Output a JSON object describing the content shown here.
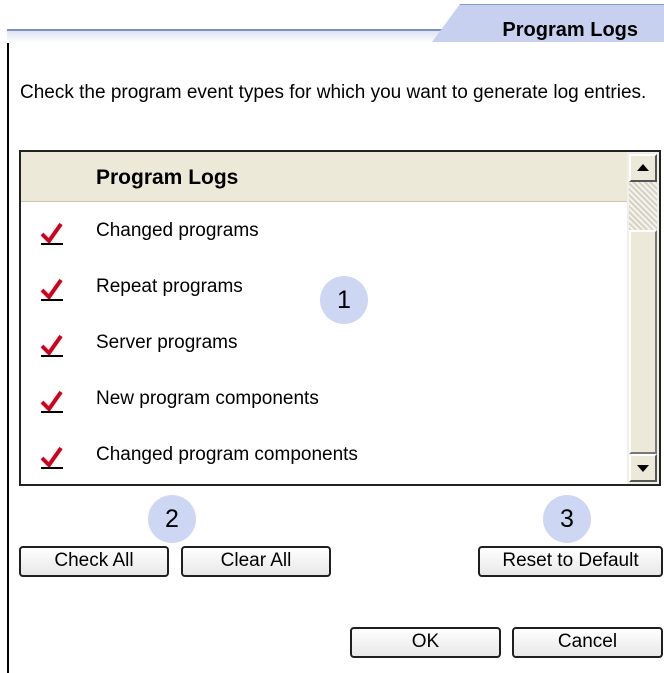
{
  "tab": {
    "label": "Program Logs"
  },
  "instructions": "Check the program event types for which you want to generate log entries.",
  "list": {
    "header": "Program Logs",
    "items": [
      {
        "label": "Changed programs",
        "checked": true
      },
      {
        "label": "Repeat programs",
        "checked": true
      },
      {
        "label": "Server programs",
        "checked": true
      },
      {
        "label": "New program components",
        "checked": true
      },
      {
        "label": "Changed program components",
        "checked": true
      }
    ]
  },
  "callouts": [
    "1",
    "2",
    "3"
  ],
  "buttons": {
    "check_all": "Check All",
    "clear_all": "Clear All",
    "reset_default": "Reset to Default",
    "ok": "OK",
    "cancel": "Cancel"
  },
  "colors": {
    "check_mark": "#d0021b",
    "callout_fill": "#cdd6f2",
    "tab_fill": "#c8d0ef"
  },
  "icons": {
    "check": "checkmark-icon",
    "scroll_up": "arrow-up-icon",
    "scroll_down": "arrow-down-icon"
  }
}
